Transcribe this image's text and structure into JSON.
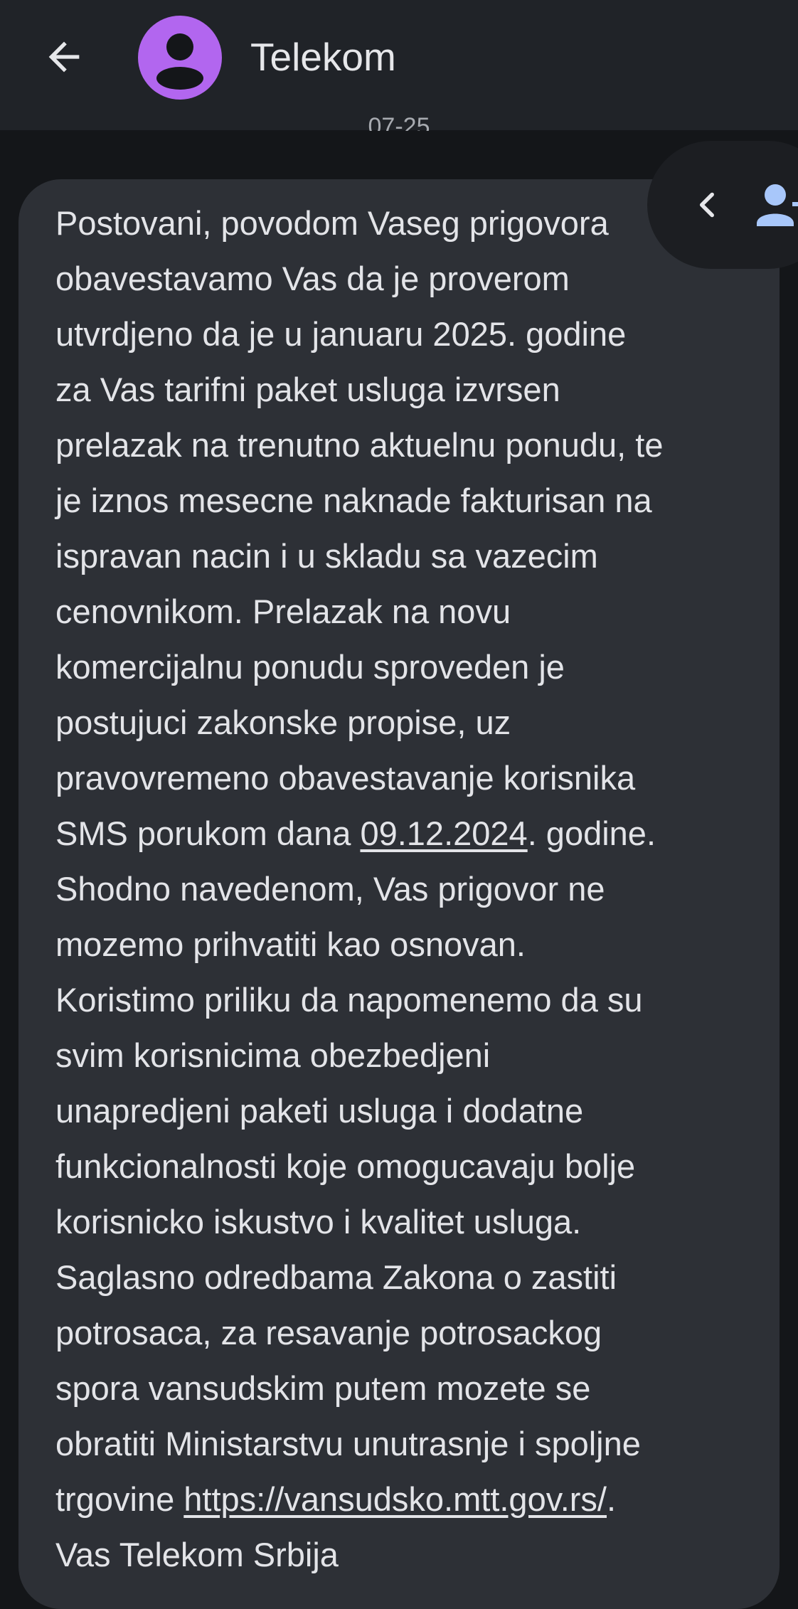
{
  "header": {
    "title": "Telekom",
    "back_icon": "arrow-back-icon",
    "avatar_icon": "person-icon",
    "avatar_color": "#b266ef"
  },
  "thread": {
    "date_separator": "07-25"
  },
  "message": {
    "lines": [
      "Postovani, povodom Vaseg prigovora",
      "obavestavamo Vas da je proverom",
      "utvrdjeno da je u januaru 2025. godine",
      "za Vas tarifni paket usluga izvrsen",
      "prelazak na trenutno aktuelnu ponudu, te",
      "je iznos mesecne naknade fakturisan na",
      "ispravan nacin i u skladu sa vazecim",
      "cenovnikom. Prelazak na novu",
      "komercijalnu ponudu sproveden je",
      "postujuci zakonske propise, uz",
      "pravovremeno obavestavanje korisnika"
    ],
    "line_sms_pre": "SMS porukom dana ",
    "line_sms_date": "09.12.2024",
    "line_sms_post": ". godine.",
    "lines2": [
      "Shodno navedenom, Vas prigovor ne",
      "mozemo prihvatiti kao osnovan.",
      "Koristimo priliku da napomenemo da su",
      "svim korisnicima obezbedjeni",
      "unapredjeni paketi usluga i dodatne",
      "funkcionalnosti koje omogucavaju bolje",
      "korisnicko iskustvo i kvalitet usluga.",
      "Saglasno odredbama Zakona o zastiti",
      "potrosaca, za resavanje potrosackog",
      "spora vansudskim putem mozete se",
      "obratiti Ministarstvu unutrasnje i spoljne"
    ],
    "line_url_pre": "trgovine ",
    "line_url": "https://vansudsko.mtt.gov.rs/",
    "line_url_post": ".",
    "signature": "Vas Telekom Srbija"
  },
  "float_bar": {
    "collapse_icon": "chevron-left-icon",
    "add_contact_icon": "add-contact-icon",
    "icon_color": "#a8c7fa"
  }
}
